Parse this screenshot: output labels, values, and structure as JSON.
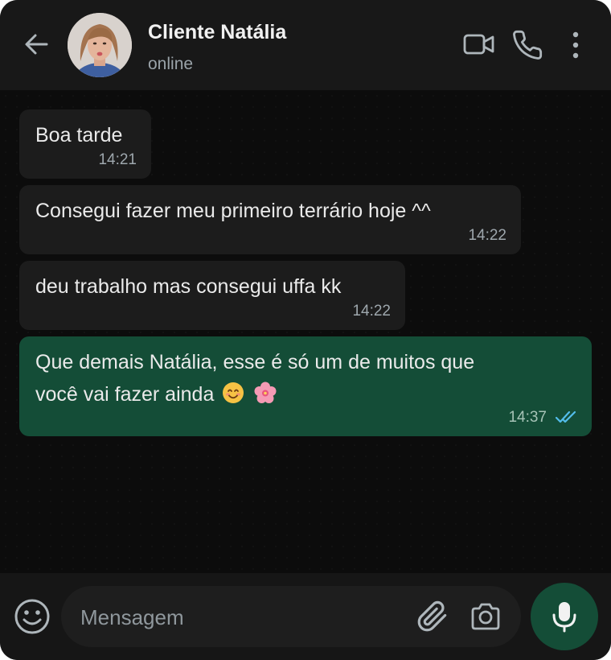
{
  "header": {
    "contact_name": "Cliente Natália",
    "status": "online"
  },
  "messages": [
    {
      "direction": "incoming",
      "text": "Boa tarde",
      "time": "14:21"
    },
    {
      "direction": "incoming",
      "text": "Consegui fazer meu primeiro terrário hoje ^^",
      "time": "14:22"
    },
    {
      "direction": "incoming",
      "text": "deu trabalho mas consegui uffa kk",
      "time": "14:22"
    },
    {
      "direction": "outgoing",
      "text_line1": "Que demais Natália, esse é só um de muitos que",
      "text_line2": "você vai fazer ainda",
      "emojis": [
        "smiling-face-emoji",
        "cherry-blossom-emoji"
      ],
      "time": "14:37",
      "status": "read"
    }
  ],
  "composer": {
    "placeholder": "Mensagem"
  },
  "icons": [
    "back-arrow-icon",
    "video-call-icon",
    "phone-icon",
    "more-options-icon",
    "emoji-icon",
    "attach-icon",
    "camera-icon",
    "microphone-icon",
    "double-check-icon"
  ],
  "colors": {
    "outgoing_bubble": "#144d37",
    "incoming_bubble": "#1c1c1c",
    "read_ticks": "#53bdeb"
  }
}
